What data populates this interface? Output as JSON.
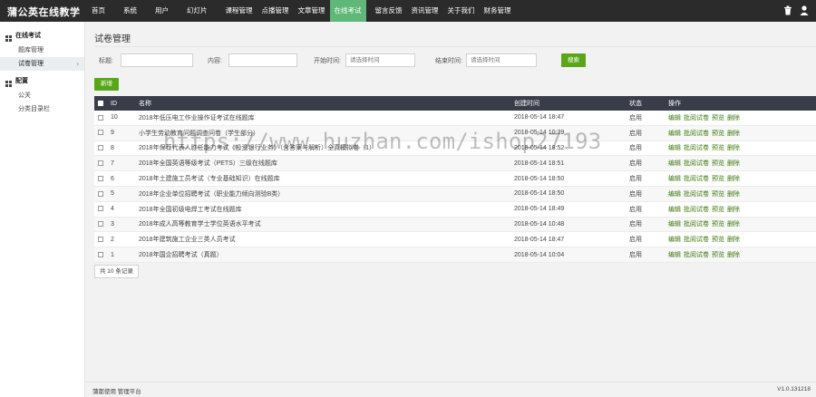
{
  "app": {
    "brand": "蒲公英在线教学"
  },
  "nav": {
    "items": [
      {
        "label": "首页"
      },
      {
        "label": "系统"
      },
      {
        "label": "用户"
      },
      {
        "label": "幻灯片"
      },
      {
        "label": "课程管理"
      },
      {
        "label": "点播管理"
      },
      {
        "label": "文章管理"
      },
      {
        "label": "在线考试"
      },
      {
        "label": "留言反馈"
      },
      {
        "label": "资讯管理"
      },
      {
        "label": "关于我们"
      },
      {
        "label": "财务管理"
      }
    ],
    "active_index": 7,
    "active_color": "#5fb878",
    "icons": [
      "trash-icon",
      "user-icon"
    ]
  },
  "sidebar": {
    "groups": [
      {
        "label": "在线考试",
        "items": [
          {
            "label": "题库管理",
            "active": false
          },
          {
            "label": "试卷管理",
            "active": true
          }
        ]
      },
      {
        "label": "配置",
        "items": [
          {
            "label": "公关",
            "active": false
          },
          {
            "label": "分类目录栏",
            "active": false
          }
        ]
      }
    ]
  },
  "main": {
    "title": "试卷管理",
    "filters": {
      "title_label": "标题:",
      "content_label": "内容:",
      "start_label": "开始时间:",
      "start_placeholder": "请选择时间",
      "end_label": "结束时间:",
      "end_placeholder": "请选择时间",
      "search_button": "搜索"
    },
    "add_button": "新增",
    "table": {
      "headers": {
        "id": "ID",
        "name": "名称",
        "created": "创建时间",
        "status": "状态",
        "ops": "操作"
      },
      "op_labels": [
        "编辑",
        "批阅试卷",
        "预览",
        "删除"
      ],
      "rows": [
        {
          "id": "10",
          "name": "2018年低压电工作业操作证考试在线题库",
          "created": "2018-05-14 18:47",
          "status": "启用"
        },
        {
          "id": "9",
          "name": "小学生劳动教育问题调查问卷（学生部分）",
          "created": "2018-05-14 10:39",
          "status": "启用"
        },
        {
          "id": "8",
          "name": "2018年保荐代表人胜任能力考试《投资银行业务》（含答案与解析）全真模拟卷（1）",
          "created": "2018-05-14 18:52",
          "status": "启用"
        },
        {
          "id": "7",
          "name": "2018年全国英语等级考试（PETS）三级在线题库",
          "created": "2018-05-14 18:51",
          "status": "启用"
        },
        {
          "id": "6",
          "name": "2018年土建施工员考试（专业基础知识）在线题库",
          "created": "2018-05-14 18:50",
          "status": "启用"
        },
        {
          "id": "5",
          "name": "2018年企业单位招聘考试（职业能力倾向测验B类）",
          "created": "2018-05-14 18:50",
          "status": "启用"
        },
        {
          "id": "4",
          "name": "2018年全国初级电焊工考试在线题库",
          "created": "2018-05-14 18:49",
          "status": "启用"
        },
        {
          "id": "3",
          "name": "2018年成人高等教育学士学位英语水平考试",
          "created": "2018-05-14 10:48",
          "status": "启用"
        },
        {
          "id": "2",
          "name": "2018年建筑施工企业三类人员考试",
          "created": "2018-05-14 18:47",
          "status": "启用"
        },
        {
          "id": "1",
          "name": "2018年国企招聘考试（真题）",
          "created": "2018-05-14 10:04",
          "status": "启用"
        }
      ]
    },
    "total": "共 10 条记录"
  },
  "footer": {
    "left": "蒲都使用  管理平台",
    "right": "V1.0.131218"
  },
  "watermark": "https://www.huzhan.com/ishop27193",
  "colors": {
    "topbar": "#2b2b2b",
    "accent_green": "#59a719",
    "table_header": "#393d49"
  }
}
